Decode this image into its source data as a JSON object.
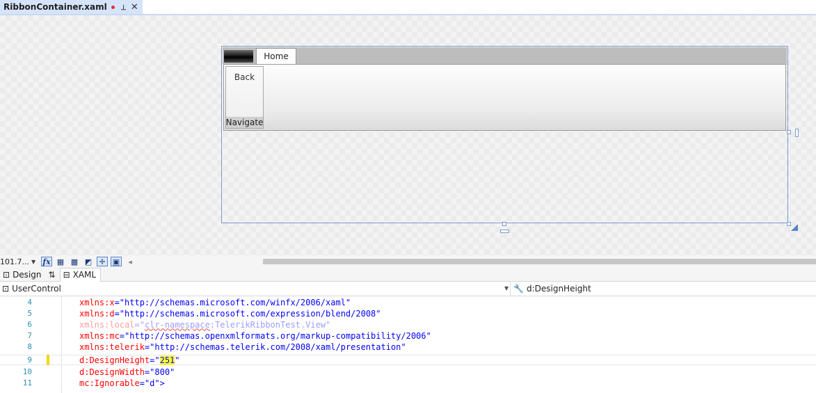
{
  "tab": {
    "title": "RibbonContainer.xaml",
    "pin_glyph": "⊣",
    "close_glyph": "✕"
  },
  "ribbon": {
    "tab_label": "Home",
    "button_label": "Back",
    "group_label": "Navigate"
  },
  "toolbar": {
    "zoom": "101.7..."
  },
  "view_switch": {
    "design": "Design",
    "swap": "⇅",
    "xaml": "XAML"
  },
  "navbar": {
    "element": "UserControl",
    "member": "d:DesignHeight"
  },
  "code": {
    "lines": [
      {
        "num": "4",
        "attr": "xmlns:x",
        "value": "http://schemas.microsoft.com/winfx/2006/xaml"
      },
      {
        "num": "5",
        "attr": "xmlns:d",
        "value": "http://schemas.microsoft.com/expression/blend/2008"
      },
      {
        "num": "6",
        "attr": "xmlns:local",
        "value_prefix": "clr-namespace",
        "value_rest": ":TelerikRibbonTest.View"
      },
      {
        "num": "7",
        "attr": "xmlns:mc",
        "value": "http://schemas.openxmlformats.org/markup-compatibility/2006"
      },
      {
        "num": "8",
        "attr": "xmlns:telerik",
        "value": "http://schemas.telerik.com/2008/xaml/presentation"
      },
      {
        "num": "9",
        "attr": "d:DesignHeight",
        "value": "251"
      },
      {
        "num": "10",
        "attr": "d:DesignWidth",
        "value": "800"
      },
      {
        "num": "11",
        "attr": "mc:Ignorable",
        "value": "d",
        "suffix": ">"
      }
    ]
  },
  "colors": {
    "accent": "#7a9ccc",
    "change_marker": "#f1d700",
    "attr": "#ff0000",
    "value": "#0000ff"
  }
}
